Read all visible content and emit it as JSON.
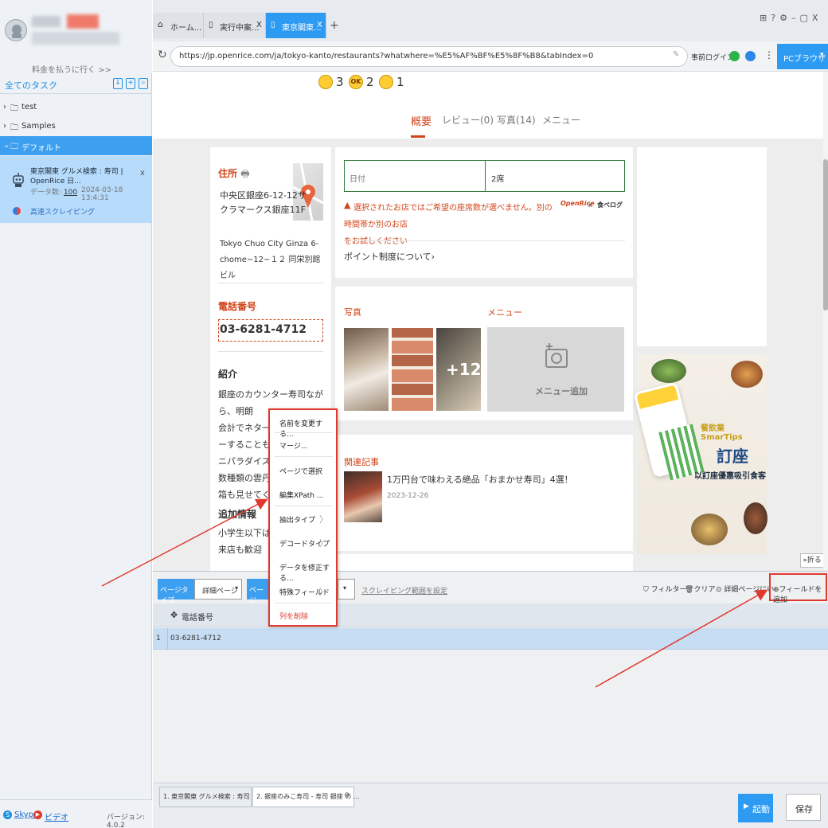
{
  "sidebar": {
    "pay_link": "料金を払うに行く >>",
    "all_tasks": "全てのタスク",
    "folders": [
      "test",
      "Samples",
      "デフォルト"
    ],
    "task": {
      "title": "東京閣東 グルメ検索 : 寿司 | OpenRice 日...",
      "data_count_label": "データ数:",
      "data_count": "100",
      "time": "2024-03-18 13:4:31",
      "mode": "高速スクレイピング",
      "close": "x"
    },
    "footer": {
      "skype": "Skype",
      "video": "ビデオ",
      "version": "バージョン: 4.0.2"
    }
  },
  "browser": {
    "tabs": [
      {
        "label": "ホーム..."
      },
      {
        "label": "実行中案..."
      },
      {
        "label": "東京閣東..."
      }
    ],
    "tab_close": "X",
    "new_tab": "+",
    "url": "https://jp.openrice.com/ja/tokyo-kanto/restaurants?whatwhere=%E5%AF%BF%E5%8F%B8&tabIndex=0",
    "login": "事前ログイン",
    "pc_browser": "PCブラウザ"
  },
  "page": {
    "ratings": [
      "3",
      "2",
      "1"
    ],
    "tabs": [
      {
        "label": "概要"
      },
      {
        "label": "レビュー(0)"
      },
      {
        "label": "写真(14)"
      },
      {
        "label": "メニュー"
      }
    ],
    "address": {
      "title": "住所",
      "jp": [
        "中央区銀座6-12-12サ",
        "クラマークス銀座11F"
      ],
      "en": [
        "Tokyo Chuo City Ginza 6-",
        "chome−12−１２ 同栄別館ビル"
      ]
    },
    "phone": {
      "title": "電話番号",
      "value": "03-6281-4712"
    },
    "intro": {
      "title": "紹介",
      "lines": [
        "銀座のカウンター寿司ながら、明朗",
        "会計でネタ一通",
        "ーすることもで",
        "ニパラダイス（",
        "数種類の雲丹を",
        "箱も見せてくれ"
      ]
    },
    "extra": {
      "title": "追加情報",
      "lines": [
        "小学生以下は無",
        "来店も歓迎"
      ]
    },
    "booking": {
      "date_label": "日付",
      "people_label": "2席",
      "warning": [
        "選択されたお店ではご希望の座席数が選べません。別の時間帯か別のお店",
        "をお試しください"
      ],
      "logos": [
        "OpenRice",
        "x",
        "食べログ"
      ],
      "points": "ポイント制度について"
    },
    "photos": {
      "title": "写真",
      "more": "+12"
    },
    "menu": {
      "title": "メニュー",
      "add": "メニュー追加"
    },
    "related": {
      "title": "関連記事",
      "article": "1万円台で味わえる絶品「おまかせ寿司」4選！",
      "date": "2023-12-26"
    },
    "ad": {
      "brand": "餐飲業 SmarTips",
      "big": "訂座",
      "tagline": "以訂座優惠吸引食客"
    },
    "fold": "折る"
  },
  "context_menu": {
    "items": [
      "名前を変更する...",
      "マージ...",
      "ページで選択",
      "編集XPath ...",
      "抽出タイプ",
      "デコードタイプ",
      "データを修正する...",
      "特殊フィールド",
      "列を削除"
    ]
  },
  "panel": {
    "page_type_label": "ページタイプ",
    "page_type_value": "詳細ページ",
    "page_type2_label": "ページ",
    "scrape_range": "スクレイピング範囲を設定",
    "filter": "フィルター",
    "clear": "クリア",
    "detail": "詳細ページにい",
    "add_field": "フィールドを追加",
    "column": "電話番号",
    "row_num": "1",
    "row_value": "03-6281-4712"
  },
  "bottom_tabs": [
    {
      "label": "1. 東京閣東 グルメ検索 : 寿司 | O..."
    },
    {
      "label": "2. 銀座のみこ寿司 - 寿司 銀座 の ..."
    }
  ],
  "actions": {
    "run": "起動",
    "save": "保存"
  }
}
